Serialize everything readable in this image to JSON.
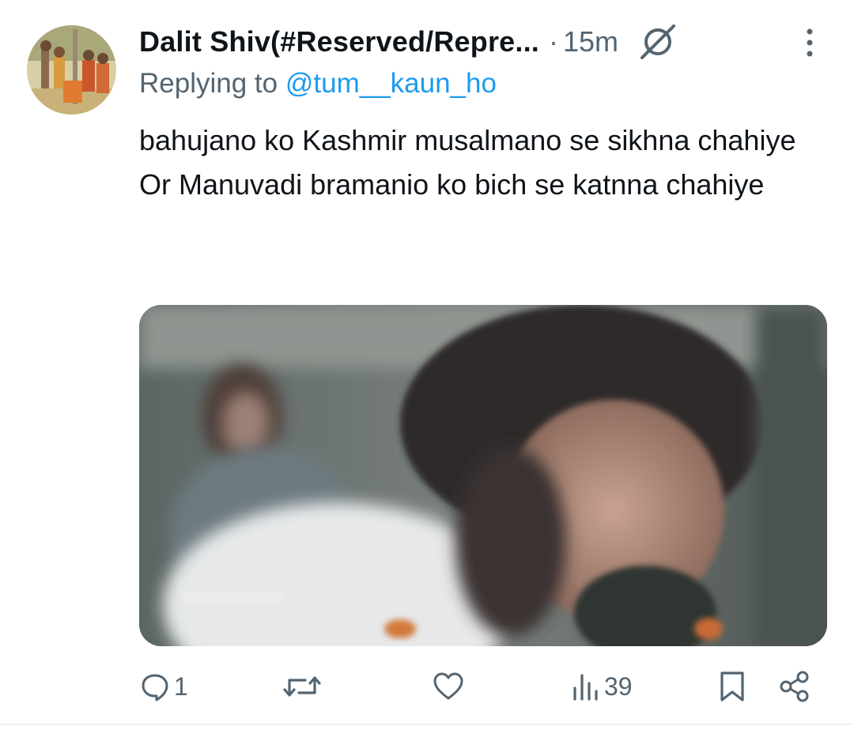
{
  "tweet": {
    "author": {
      "display_name": "Dalit Shiv(#Reserved/Repre...",
      "avatar_icon": "avatar-image"
    },
    "separator": "·",
    "timestamp": "15m",
    "reply": {
      "prefix": "Replying to",
      "mention": "@tum__kaun_ho"
    },
    "text_lines": [
      "bahujano ko Kashmir musalmano se sikhna chahiye",
      "Or Manuvadi bramanio ko bich se katnna chahiye"
    ],
    "media": {
      "type": "video-thumbnail"
    },
    "actions": {
      "reply_count": "1",
      "retweet_count": "",
      "like_count": "",
      "views_count": "39"
    }
  },
  "colors": {
    "text": "#0f1419",
    "secondary": "#536471",
    "link": "#1d9bf0",
    "divider": "#eff3f4"
  }
}
